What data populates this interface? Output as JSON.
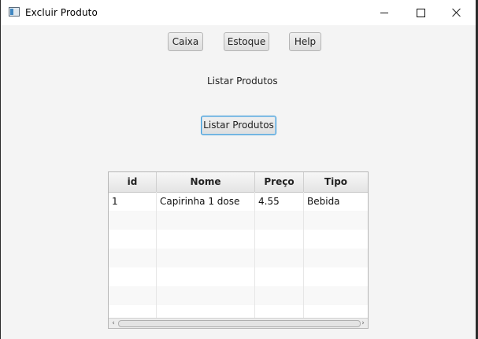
{
  "window": {
    "title": "Excluir  Produto"
  },
  "nav": {
    "caixa": "Caixa",
    "estoque": "Estoque",
    "help": "Help"
  },
  "main": {
    "label": "Listar Produtos",
    "list_button": "Listar Produtos"
  },
  "table": {
    "columns": [
      "id",
      "Nome",
      "Preço",
      "Tipo"
    ],
    "rows": [
      [
        "1",
        "Capirinha 1 dose",
        "4.55",
        "Bebida"
      ]
    ]
  }
}
